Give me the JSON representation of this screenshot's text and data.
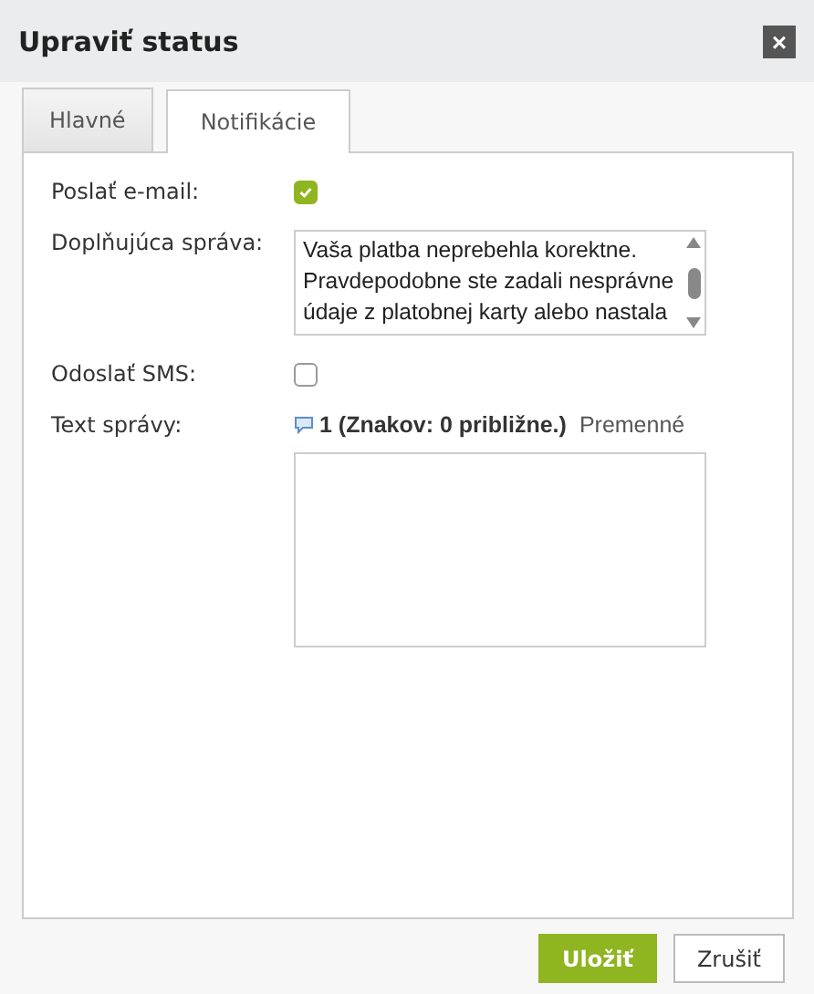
{
  "window": {
    "title": "Upraviť status",
    "close": "×"
  },
  "tabs": [
    {
      "label": "Hlavné",
      "selected": false
    },
    {
      "label": "Notifikácie",
      "selected": true
    }
  ],
  "form": {
    "send_email": {
      "label": "Poslať e-mail:",
      "checked": true
    },
    "extra_message": {
      "label": "Doplňujúca správa:",
      "value": "Vaša platba neprebehla korektne. Pravdepodobne ste zadali nesprávne údaje z platobnej karty alebo nastala"
    },
    "send_sms": {
      "label": "Odoslať SMS:",
      "checked": false
    },
    "sms_text": {
      "label": "Text správy:",
      "counter": "1 (Znakov: 0 približne.)",
      "variables_link": "Premenné"
    }
  },
  "buttons": [
    {
      "label": "Uložiť",
      "kind": "primary"
    },
    {
      "label": "Zrušiť",
      "kind": "secondary"
    }
  ]
}
